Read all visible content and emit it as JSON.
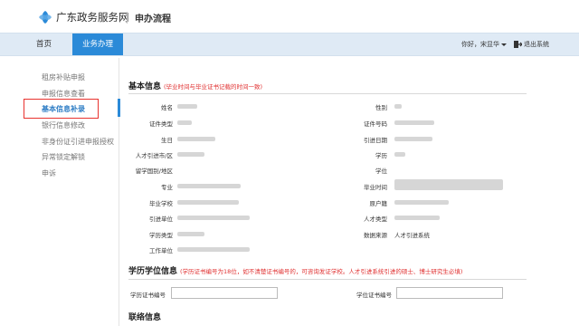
{
  "header": {
    "brand": "广东政务服务网",
    "subtitle": "申办流程"
  },
  "nav": {
    "home": "首页",
    "business": "业务办理",
    "user": "你好，宋显华",
    "logout": "退出系统"
  },
  "sidebar": {
    "items": [
      {
        "label": "租房补贴申报",
        "active": false
      },
      {
        "label": "申报信息查看",
        "active": false
      },
      {
        "label": "基本信息补录",
        "active": true
      },
      {
        "label": "银行信息修改",
        "active": false
      },
      {
        "label": "非身份证引进申报授权",
        "active": false
      },
      {
        "label": "异常锁定解锁",
        "active": false
      },
      {
        "label": "申诉",
        "active": false
      }
    ]
  },
  "basic": {
    "title": "基本信息",
    "note": "(毕业时间与毕业证书记载的时间一致)",
    "labels": {
      "name": "姓名",
      "gender": "性别",
      "id_type": "证件类型",
      "id_no": "证件号码",
      "birthday": "生日",
      "intro_date": "引进日期",
      "talent_city": "人才引进市/区",
      "degree_level": "学历",
      "abroad_country": "留学国别/地区",
      "degree": "学位",
      "major": "专业",
      "grad_time": "毕业时间",
      "school": "毕业学校",
      "former_major": "原户籍",
      "intro_unit": "引进单位",
      "talent_type": "人才类型",
      "edu_type": "学历类型",
      "data_source": "数据来源",
      "work_unit": "工作单位"
    },
    "data_source_value": "人才引进系统"
  },
  "edu": {
    "title": "学历学位信息",
    "note": "(学历证书编号为18位，如不清楚证书编号的，可咨询发证学校。人才引进系统引进的硕士、博士研究生必填)",
    "cert_no_label": "学历证书编号",
    "degree_no_label": "学位证书编号",
    "cert_no_value": "",
    "degree_no_value": ""
  },
  "contact": {
    "title": "联络信息"
  },
  "colors": {
    "accent": "#2b8ad8",
    "nav_bg": "#dfeaf5",
    "highlight": "#e8322e",
    "note": "#e03030"
  }
}
